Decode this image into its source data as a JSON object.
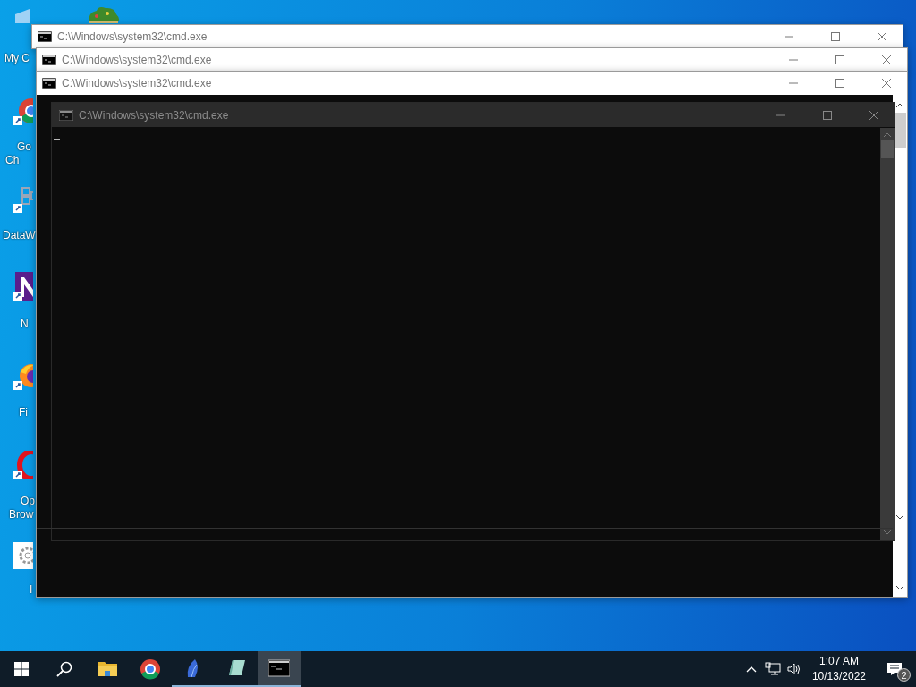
{
  "desktop_icons": [
    {
      "kind": "computer",
      "label_lines": [
        "My C"
      ]
    },
    {
      "kind": "tree"
    },
    {
      "kind": "ring",
      "label_lines": [
        "Go",
        "Ch"
      ]
    },
    {
      "kind": "grid",
      "label_lines": [
        "DataW"
      ]
    },
    {
      "kind": "letter",
      "label_lines": [
        "N"
      ]
    },
    {
      "kind": "flame",
      "label_lines": [
        "Fi"
      ]
    },
    {
      "kind": "o",
      "label_lines": [
        "Op",
        "Brow"
      ]
    },
    {
      "kind": "gear",
      "label_lines": [
        "I"
      ]
    }
  ],
  "windows": [
    {
      "title": "C:\\Windows\\system32\\cmd.exe"
    },
    {
      "title": "C:\\Windows\\system32\\cmd.exe"
    },
    {
      "title": "C:\\Windows\\system32\\cmd.exe"
    }
  ],
  "console": {
    "title": "C:\\Windows\\system32\\cmd.exe"
  },
  "taskbar": {
    "apps": [
      {
        "kind": "folder",
        "running": false,
        "active": false
      },
      {
        "kind": "ring",
        "running": false,
        "active": false
      },
      {
        "kind": "feather",
        "running": true,
        "active": false
      },
      {
        "kind": "notepad",
        "running": true,
        "active": false
      },
      {
        "kind": "terminal",
        "running": true,
        "active": true
      }
    ]
  },
  "tray": {
    "time": "1:07 AM",
    "date": "10/13/2022",
    "notification_count": "2"
  }
}
